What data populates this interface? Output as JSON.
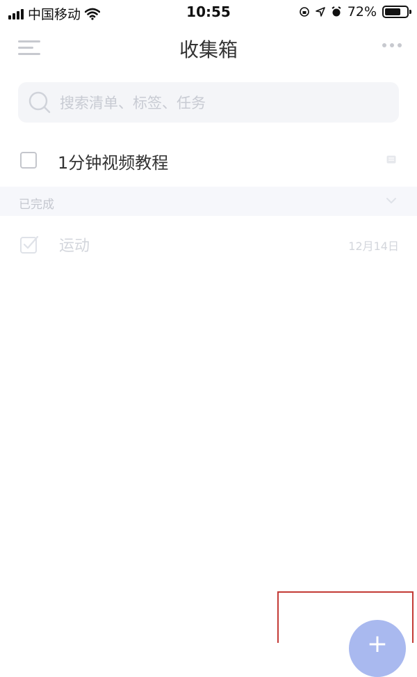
{
  "status_bar": {
    "carrier": "中国移动",
    "time": "10:55",
    "battery": "72%",
    "battery_level": 0.72,
    "icons": [
      "signal-icon",
      "wifi-icon",
      "rotation-lock-icon",
      "location-icon",
      "alarm-icon",
      "battery-icon"
    ]
  },
  "navbar": {
    "title": "收集箱",
    "icons": [
      "menu-icon",
      "more-icon"
    ]
  },
  "search": {
    "placeholder": "搜索清单、标签、任务"
  },
  "tasks": [
    {
      "title": "1分钟视频教程",
      "checked": false,
      "icon": "note-icon"
    }
  ],
  "completed_section": {
    "label": "已完成",
    "icon": "chevron-down-icon",
    "items": [
      {
        "title": "运动",
        "date": "12月14日",
        "checked": true
      }
    ]
  },
  "fab": {
    "label": "+",
    "color": "#a9b9ef"
  },
  "colors": {
    "highlight_border": "#c33a35",
    "muted": "#c7c9cf"
  }
}
